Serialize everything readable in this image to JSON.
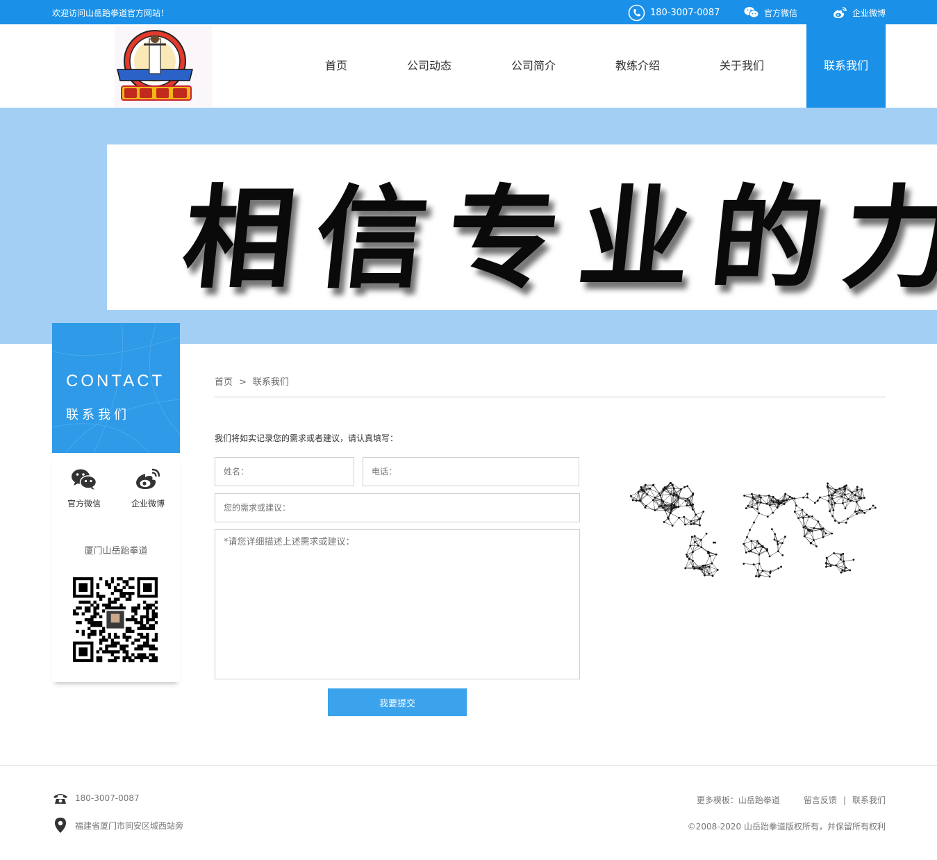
{
  "topbar": {
    "welcome": "欢迎访问山岳跆拳道官方网站！",
    "phone": "180-3007-0087",
    "wechat": "官方微信",
    "weibo": "企业微博"
  },
  "nav": {
    "items": [
      "首页",
      "公司动态",
      "公司简介",
      "教练介绍",
      "关于我们",
      "联系我们"
    ],
    "active": "联系我们"
  },
  "banner": {
    "text": "相信专业的力"
  },
  "sidebar": {
    "title_en": "CONTACT",
    "title_cn": "联系我们",
    "wechat_label": "官方微信",
    "weibo_label": "企业微博",
    "company": "厦门山岳跆拳道"
  },
  "breadcrumb": {
    "home": "首页",
    "sep": ">",
    "current": "联系我们"
  },
  "form": {
    "intro": "我们将如实记录您的需求或者建议，请认真填写：",
    "name_placeholder": "姓名：",
    "phone_placeholder": "电话：",
    "need_placeholder": "您的需求或建议：",
    "detail_placeholder": "*请您详细描述上述需求或建议：",
    "submit": "我要提交"
  },
  "footer": {
    "phone": "180-3007-0087",
    "address": "福建省厦门市同安区城西站旁",
    "more": "更多模板：山岳跆拳道",
    "feedback": "留言反馈",
    "bar": "|",
    "contact": "联系我们",
    "copyright": "©2008-2020 山岳跆拳道版权所有，并保留所有权利"
  },
  "colors": {
    "brand": "#1a90e8",
    "banner_bg": "#a4cff4",
    "button": "#3aa3ec"
  },
  "icons": [
    "phone-icon",
    "wechat-icon",
    "weibo-icon",
    "telephone-icon",
    "location-pin-icon"
  ]
}
